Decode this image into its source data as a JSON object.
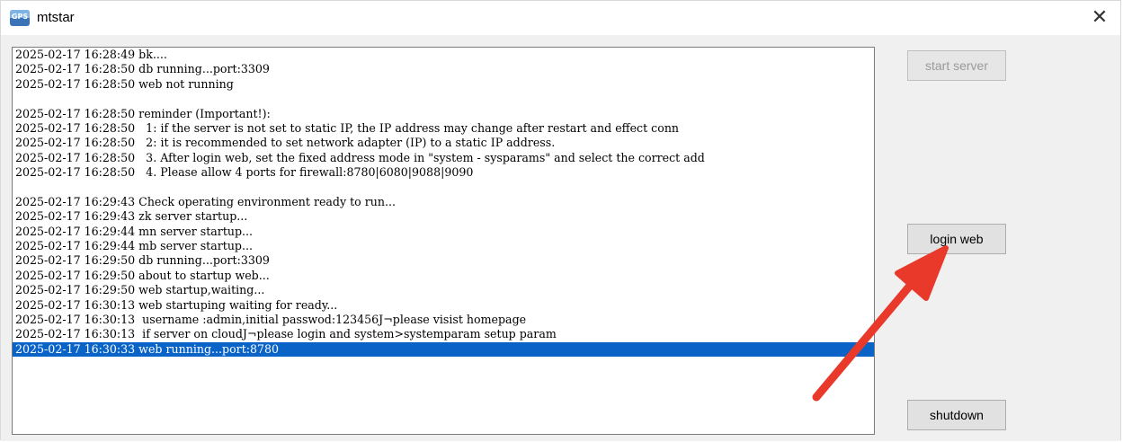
{
  "window": {
    "title": "mtstar",
    "icon": "mtstar-app-icon",
    "icon_text": "GPS"
  },
  "log": {
    "lines": [
      "2025-02-17 16:28:49 bk....",
      "2025-02-17 16:28:50 db running...port:3309",
      "2025-02-17 16:28:50 web not running",
      "",
      "2025-02-17 16:28:50 reminder (Important!):",
      "2025-02-17 16:28:50   1: if the server is not set to static IP, the IP address may change after restart and effect conn",
      "2025-02-17 16:28:50   2: it is recommended to set network adapter (IP) to a static IP address.",
      "2025-02-17 16:28:50   3. After login web, set the fixed address mode in \"system - sysparams\" and select the correct add",
      "2025-02-17 16:28:50   4. Please allow 4 ports for firewall:8780|6080|9088|9090",
      "",
      "2025-02-17 16:29:43 Check operating environment ready to run...",
      "2025-02-17 16:29:43 zk server startup...",
      "2025-02-17 16:29:44 mn server startup...",
      "2025-02-17 16:29:44 mb server startup...",
      "2025-02-17 16:29:50 db running...port:3309",
      "2025-02-17 16:29:50 about to startup web...",
      "2025-02-17 16:29:50 web startup,waiting...",
      "2025-02-17 16:30:13 web startuping waiting for ready...",
      "2025-02-17 16:30:13  username :admin,initial passwod:123456J¬please visist homepage",
      "2025-02-17 16:30:13  if server on cloudJ¬please login and system>systemparam setup param",
      "2025-02-17 16:30:33 web running...port:8780"
    ],
    "selected_index": 20
  },
  "buttons": {
    "start_server": "start server",
    "login_web": "login web",
    "shutdown": "shutdown"
  },
  "annotation": {
    "arrow_color": "#e8392b"
  },
  "colors": {
    "selection": "#0a64c8"
  }
}
